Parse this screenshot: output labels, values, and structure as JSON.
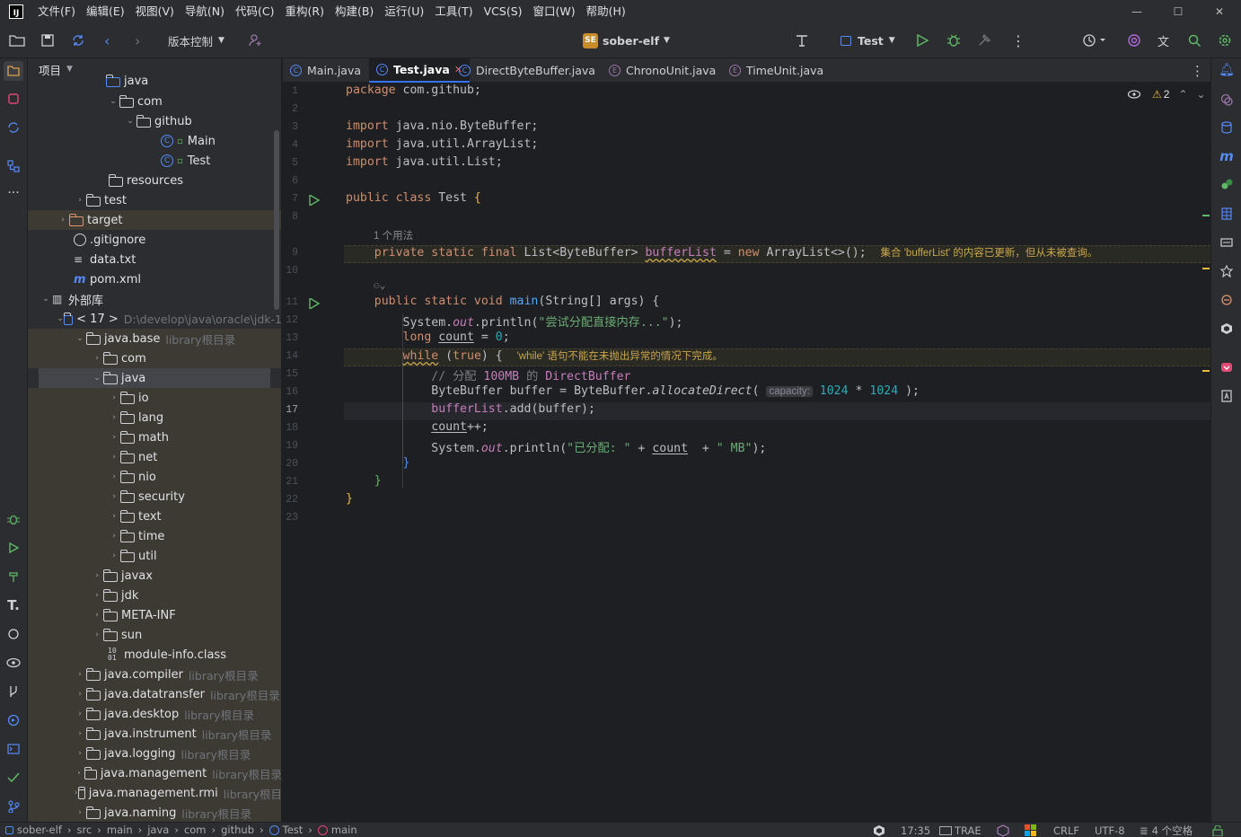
{
  "menubar": {
    "items": [
      "文件(F)",
      "编辑(E)",
      "视图(V)",
      "导航(N)",
      "代码(C)",
      "重构(R)",
      "构建(B)",
      "运行(U)",
      "工具(T)",
      "VCS(S)",
      "窗口(W)",
      "帮助(H)"
    ]
  },
  "toolbar": {
    "vcs_label": "版本控制",
    "project_badge": "SE",
    "project_name": "sober-elf",
    "run_config": "Test"
  },
  "project_panel": {
    "title": "项目",
    "rows": [
      {
        "label": "java"
      },
      {
        "label": "com"
      },
      {
        "label": "github"
      },
      {
        "label": "Main"
      },
      {
        "label": "Test"
      },
      {
        "label": "resources"
      },
      {
        "label": "test"
      },
      {
        "label": "target"
      },
      {
        "label": ".gitignore"
      },
      {
        "label": "data.txt"
      },
      {
        "label": "pom.xml"
      },
      {
        "label": "外部库"
      },
      {
        "label": "< 17 >",
        "extra": "D:\\develop\\java\\oracle\\jdk-1"
      },
      {
        "label": "java.base",
        "extra": "library根目录"
      },
      {
        "label": "com"
      },
      {
        "label": "java"
      },
      {
        "label": "io"
      },
      {
        "label": "lang"
      },
      {
        "label": "math"
      },
      {
        "label": "net"
      },
      {
        "label": "nio"
      },
      {
        "label": "security"
      },
      {
        "label": "text"
      },
      {
        "label": "time"
      },
      {
        "label": "util"
      },
      {
        "label": "javax"
      },
      {
        "label": "jdk"
      },
      {
        "label": "META-INF"
      },
      {
        "label": "sun"
      },
      {
        "label": "module-info.class"
      },
      {
        "label": "java.compiler",
        "extra": "library根目录"
      },
      {
        "label": "java.datatransfer",
        "extra": "library根目录"
      },
      {
        "label": "java.desktop",
        "extra": "library根目录"
      },
      {
        "label": "java.instrument",
        "extra": "library根目录"
      },
      {
        "label": "java.logging",
        "extra": "library根目录"
      },
      {
        "label": "java.management",
        "extra": "library根目录"
      },
      {
        "label": "java.management.rmi",
        "extra": "library根目"
      },
      {
        "label": "java.naming",
        "extra": "library根目录"
      }
    ]
  },
  "tabs": [
    {
      "label": "Main.java"
    },
    {
      "label": "Test.java"
    },
    {
      "label": "DirectByteBuffer.java"
    },
    {
      "label": "ChronoUnit.java"
    },
    {
      "label": "TimeUnit.java"
    }
  ],
  "editor": {
    "line_numbers": [
      "1",
      "2",
      "3",
      "4",
      "5",
      "6",
      "7",
      "8",
      "9",
      "10",
      "11",
      "12",
      "13",
      "14",
      "15",
      "16",
      "17",
      "18",
      "19",
      "20",
      "21",
      "22",
      "23"
    ],
    "warning_count": "2",
    "usage_hint": "1 个用法",
    "code": {
      "l1a": "package",
      "l1b": " com.github;",
      "l3a": "import",
      "l3b": " java.nio.ByteBuffer;",
      "l4a": "import",
      "l4b": " java.util.ArrayList;",
      "l5a": "import",
      "l5b": " java.util.List;",
      "l7a": "public class",
      "l7b": " Test ",
      "l7c": "{",
      "l9a": "    private static final",
      "l9b": " List<ByteBuffer> ",
      "l9c": "bufferList",
      "l9d": " = ",
      "l9e": "new",
      "l9f": " ArrayList<>();",
      "l9hint": "集合 'bufferList' 的内容已更新，但从未被查询。",
      "l11a": "    public static void",
      "l11b": " main",
      "l11c": "(String[] args) {",
      "l12a": "        System.",
      "l12b": "out",
      "l12c": ".println(",
      "l12d": "\"尝试分配直接内存...\"",
      "l12e": ");",
      "l13a": "        long",
      "l13b": "count",
      "l13c": " = ",
      "l13d": "0",
      "l13e": ";",
      "l14a": "while",
      "l14b": " (",
      "l14c": "true",
      "l14d": ") {",
      "l14hint": "'while' 语句不能在未抛出异常的情况下完成。",
      "l15a": "            // 分配 ",
      "l15b": "100MB",
      "l15c": " 的 ",
      "l15d": "DirectBuffer",
      "l16a": "            ByteBuffer buffer = ByteBuffer.",
      "l16b": "allocateDirect",
      "l16c": "(",
      "l16hint": "capacity:",
      "l16d": " 1024",
      "l16e": " * ",
      "l16f": "1024",
      "l16g": " );",
      "l17a": "bufferList",
      "l17b": ".add(buffer);",
      "l18a": "count",
      "l18b": "++;",
      "l19a": "            System.",
      "l19b": "out",
      "l19c": ".println(",
      "l19d": "\"已分配: \"",
      "l19e": " + ",
      "l19f": "count",
      "l19g": "  + ",
      "l19h": "\" MB\"",
      "l19i": ");",
      "l20": "        }",
      "l21": "    }",
      "l22": "}"
    }
  },
  "statusbar": {
    "breadcrumbs": [
      "sober-elf",
      "src",
      "main",
      "java",
      "com",
      "github",
      "Test",
      "main"
    ],
    "time": "17:35",
    "trae": "TRAE",
    "line_sep": "CRLF",
    "encoding": "UTF-8",
    "indent": "4 个空格"
  },
  "colors": {
    "accent": "#3574f0",
    "keyword": "#cf8e6d",
    "string": "#6aab73",
    "field": "#c77dbb",
    "number": "#2aacb8",
    "warning": "#c9a64b"
  }
}
